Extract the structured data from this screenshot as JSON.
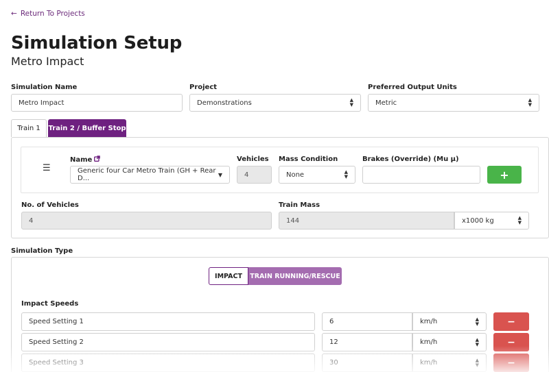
{
  "nav": {
    "back_arrow": "←",
    "back_label": "Return To Projects"
  },
  "page": {
    "title": "Simulation Setup",
    "subtitle": "Metro Impact"
  },
  "form": {
    "sim_name_label": "Simulation Name",
    "sim_name_value": "Metro Impact",
    "project_label": "Project",
    "project_value": "Demonstrations",
    "units_label": "Preferred Output Units",
    "units_value": "Metric"
  },
  "tabs": [
    {
      "label": "Train 1"
    },
    {
      "label": "Train 2 / Buffer Stop"
    }
  ],
  "train": {
    "name_label": "Name",
    "name_value": "Generic four Car Metro Train (GH + Rear D...",
    "vehicles_label": "Vehicles",
    "vehicles_value": "4",
    "mass_condition_label": "Mass Condition",
    "mass_condition_value": "None",
    "brakes_label": "Brakes (Override) (Mu μ)",
    "brakes_value": "",
    "add_label": "+",
    "num_vehicles_label": "No. of Vehicles",
    "num_vehicles_value": "4",
    "train_mass_label": "Train Mass",
    "train_mass_value": "144",
    "mass_unit_value": "x1000 kg"
  },
  "simulation": {
    "type_label": "Simulation Type",
    "impact_label": "IMPACT",
    "running_label": "TRAIN RUNNING/RESCUE",
    "speeds_label": "Impact Speeds",
    "speeds": [
      {
        "name": "Speed Setting 1",
        "value": "6",
        "unit": "km/h",
        "remove": "−"
      },
      {
        "name": "Speed Setting 2",
        "value": "12",
        "unit": "km/h",
        "remove": "−"
      },
      {
        "name": "Speed Setting 3",
        "value": "30",
        "unit": "km/h",
        "remove": "−"
      }
    ]
  },
  "colors": {
    "brand": "#6e2180",
    "add": "#49b449",
    "remove": "#d9534f"
  }
}
